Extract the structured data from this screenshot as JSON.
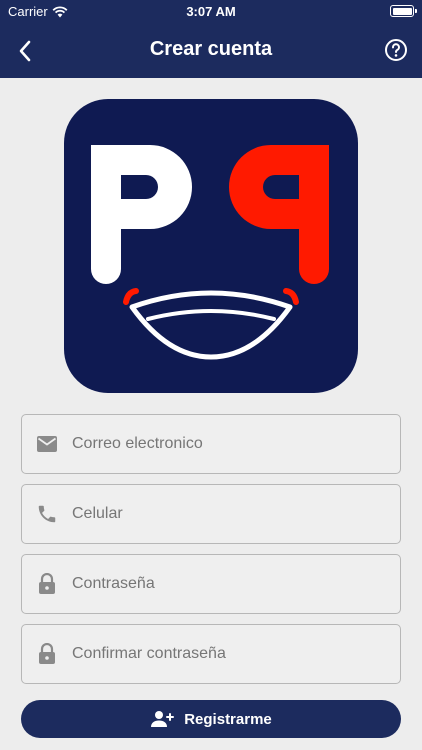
{
  "status_bar": {
    "carrier": "Carrier",
    "time": "3:07 AM"
  },
  "navbar": {
    "title": "Crear cuenta",
    "back_icon": "chevron-left-icon",
    "help_icon": "help-circle-icon"
  },
  "logo": {
    "letters": "PP",
    "letter_colors": [
      "#ffffff",
      "#ff1a00"
    ],
    "background": "#0f1a52"
  },
  "form": {
    "fields": [
      {
        "placeholder": "Correo electronico",
        "icon": "email-icon"
      },
      {
        "placeholder": "Celular",
        "icon": "phone-icon"
      },
      {
        "placeholder": "Contraseña",
        "icon": "lock-icon"
      },
      {
        "placeholder": "Confirmar contraseña",
        "icon": "lock-icon"
      }
    ]
  },
  "register_button": {
    "label": "Registrarme",
    "icon": "add-user-icon"
  },
  "colors": {
    "primary": "#1c2b5e",
    "background": "#ededed",
    "accent_red": "#ff1a00"
  }
}
